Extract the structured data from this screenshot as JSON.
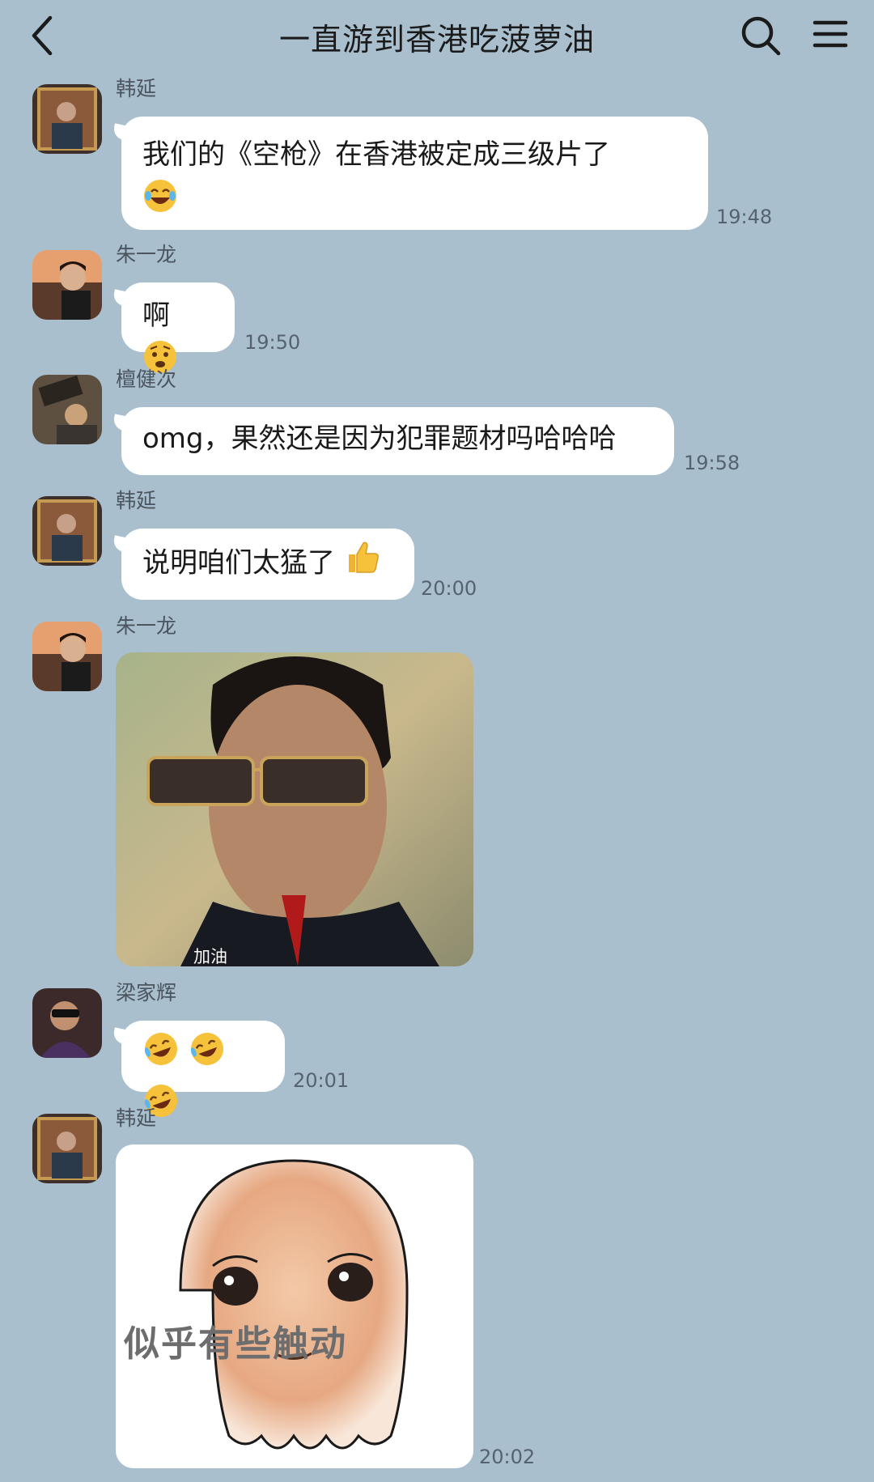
{
  "header": {
    "title": "一直游到香港吃菠萝油"
  },
  "messages": [
    {
      "sender": "韩延",
      "text": "我们的《空枪》在香港被定成三级片了",
      "emoji": "tears-of-joy",
      "time": "19:48"
    },
    {
      "sender": "朱一龙",
      "text": "啊",
      "emoji": "worried-face",
      "time": "19:50"
    },
    {
      "sender": "檀健次",
      "text": "omg，果然还是因为犯罪题材吗哈哈哈",
      "time": "19:58"
    },
    {
      "sender": "韩延",
      "text": "说明咱们太猛了",
      "emoji": "thumbs-up",
      "time": "20:00"
    },
    {
      "sender": "朱一龙",
      "sticker_caption": "加油"
    },
    {
      "sender": "梁家辉",
      "emoji": "rolling-on-floor-laughing",
      "emoji_count": 3,
      "time": "20:01"
    },
    {
      "sender": "韩延",
      "sticker_caption": "似乎有些触动",
      "time": "20:02"
    }
  ],
  "colors": {
    "chat_bg": "#a9bfce",
    "bubble": "#ffffff"
  }
}
